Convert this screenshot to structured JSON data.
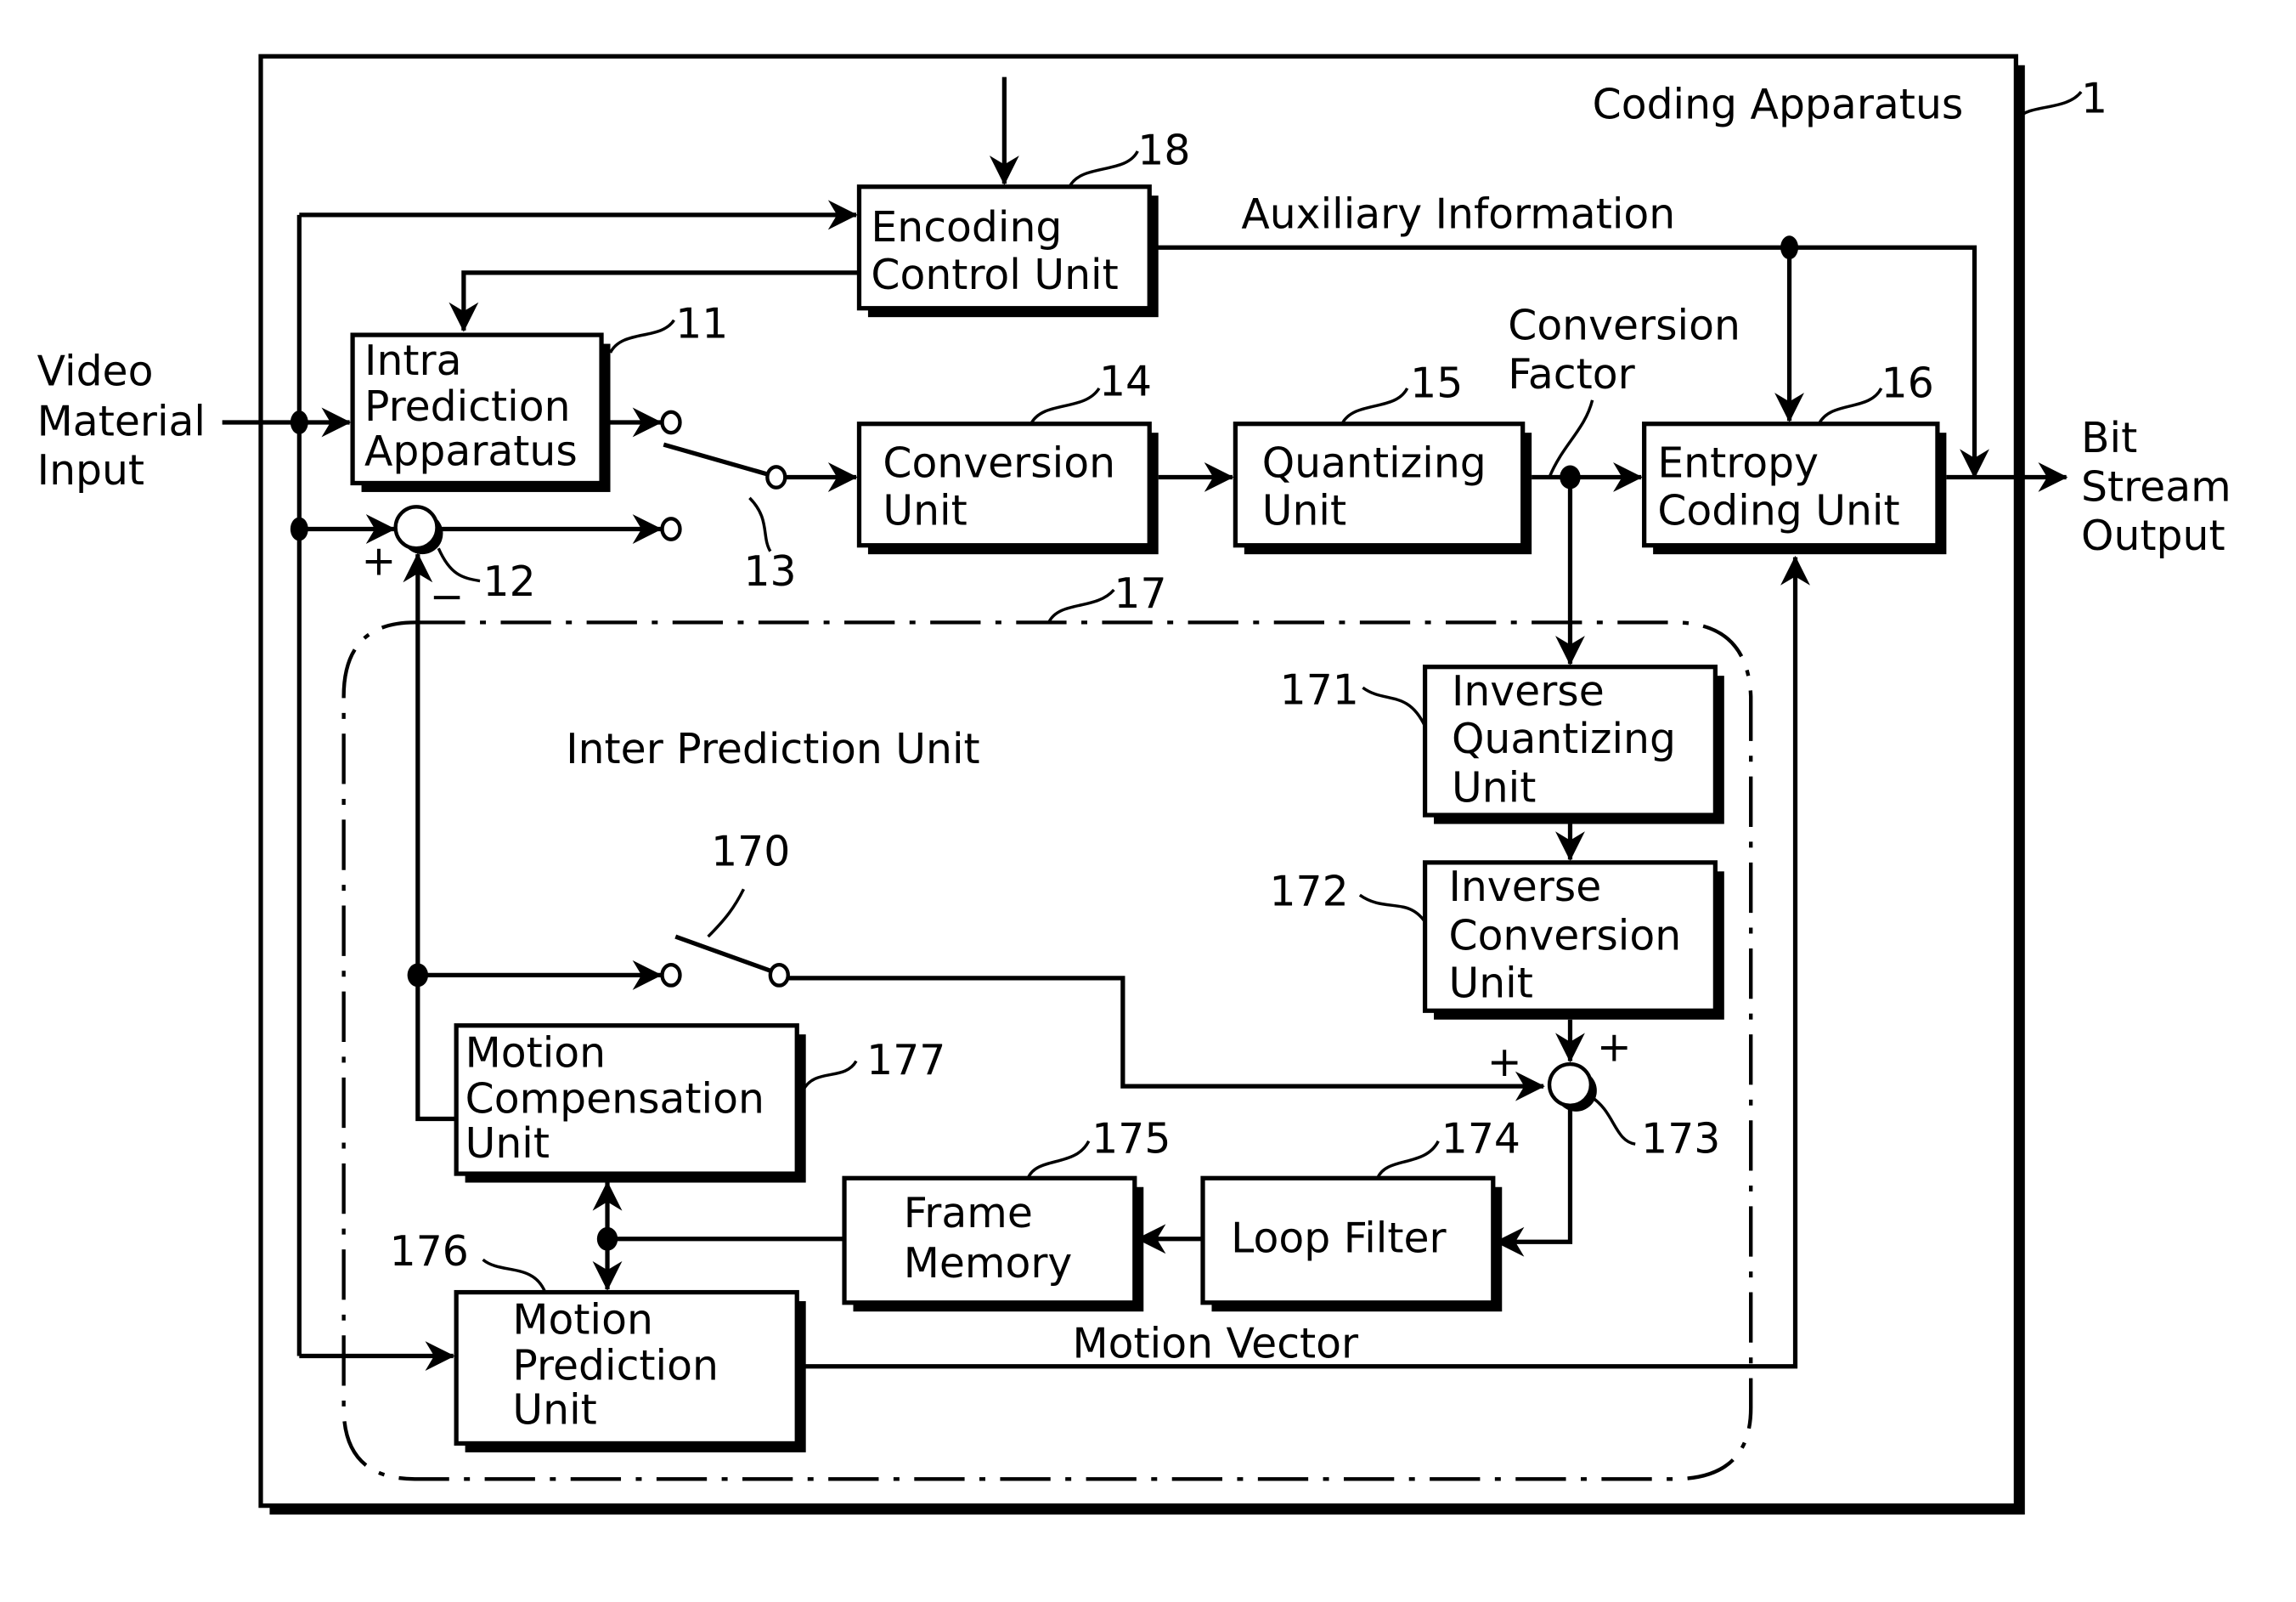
{
  "diagram": {
    "title": "Coding Apparatus",
    "title_ref": "1",
    "inputs": {
      "video_input": [
        "Video",
        "Material",
        "Input"
      ]
    },
    "outputs": {
      "bitstream_output": [
        "Bit",
        "Stream",
        "Output"
      ]
    },
    "signal_labels": {
      "auxiliary_information": "Auxiliary Information",
      "conversion_factor": [
        "Conversion",
        "Factor"
      ],
      "motion_vector": "Motion Vector"
    },
    "blocks": {
      "encoding_control": {
        "lines": [
          "Encoding",
          "Control Unit"
        ],
        "ref": "18"
      },
      "intra_prediction": {
        "lines": [
          "Intra",
          "Prediction",
          "Apparatus"
        ],
        "ref": "11"
      },
      "conversion": {
        "lines": [
          "Conversion",
          "Unit"
        ],
        "ref": "14"
      },
      "quantizing": {
        "lines": [
          "Quantizing",
          "Unit"
        ],
        "ref": "15"
      },
      "entropy_coding": {
        "lines": [
          "Entropy",
          "Coding Unit"
        ],
        "ref": "16"
      },
      "inverse_quantizing": {
        "lines": [
          "Inverse",
          "Quantizing",
          "Unit"
        ],
        "ref": "171"
      },
      "inverse_conversion": {
        "lines": [
          "Inverse",
          "Conversion",
          "Unit"
        ],
        "ref": "172"
      },
      "loop_filter": {
        "lines": [
          "Loop Filter"
        ],
        "ref": "174"
      },
      "frame_memory": {
        "lines": [
          "Frame",
          "Memory"
        ],
        "ref": "175"
      },
      "motion_compensation": {
        "lines": [
          "Motion",
          "Compensation",
          "Unit"
        ],
        "ref": "177"
      },
      "motion_prediction": {
        "lines": [
          "Motion",
          "Prediction",
          "Unit"
        ],
        "ref": "176"
      }
    },
    "inter_prediction_unit": {
      "label": "Inter Prediction Unit",
      "ref": "17"
    },
    "subtractor": {
      "ref": "12",
      "plus": "+",
      "minus": "−"
    },
    "adder": {
      "ref": "173",
      "plus_left": "+",
      "plus_top": "+"
    },
    "switch_main": {
      "ref": "13"
    },
    "switch_inter": {
      "ref": "170"
    }
  }
}
